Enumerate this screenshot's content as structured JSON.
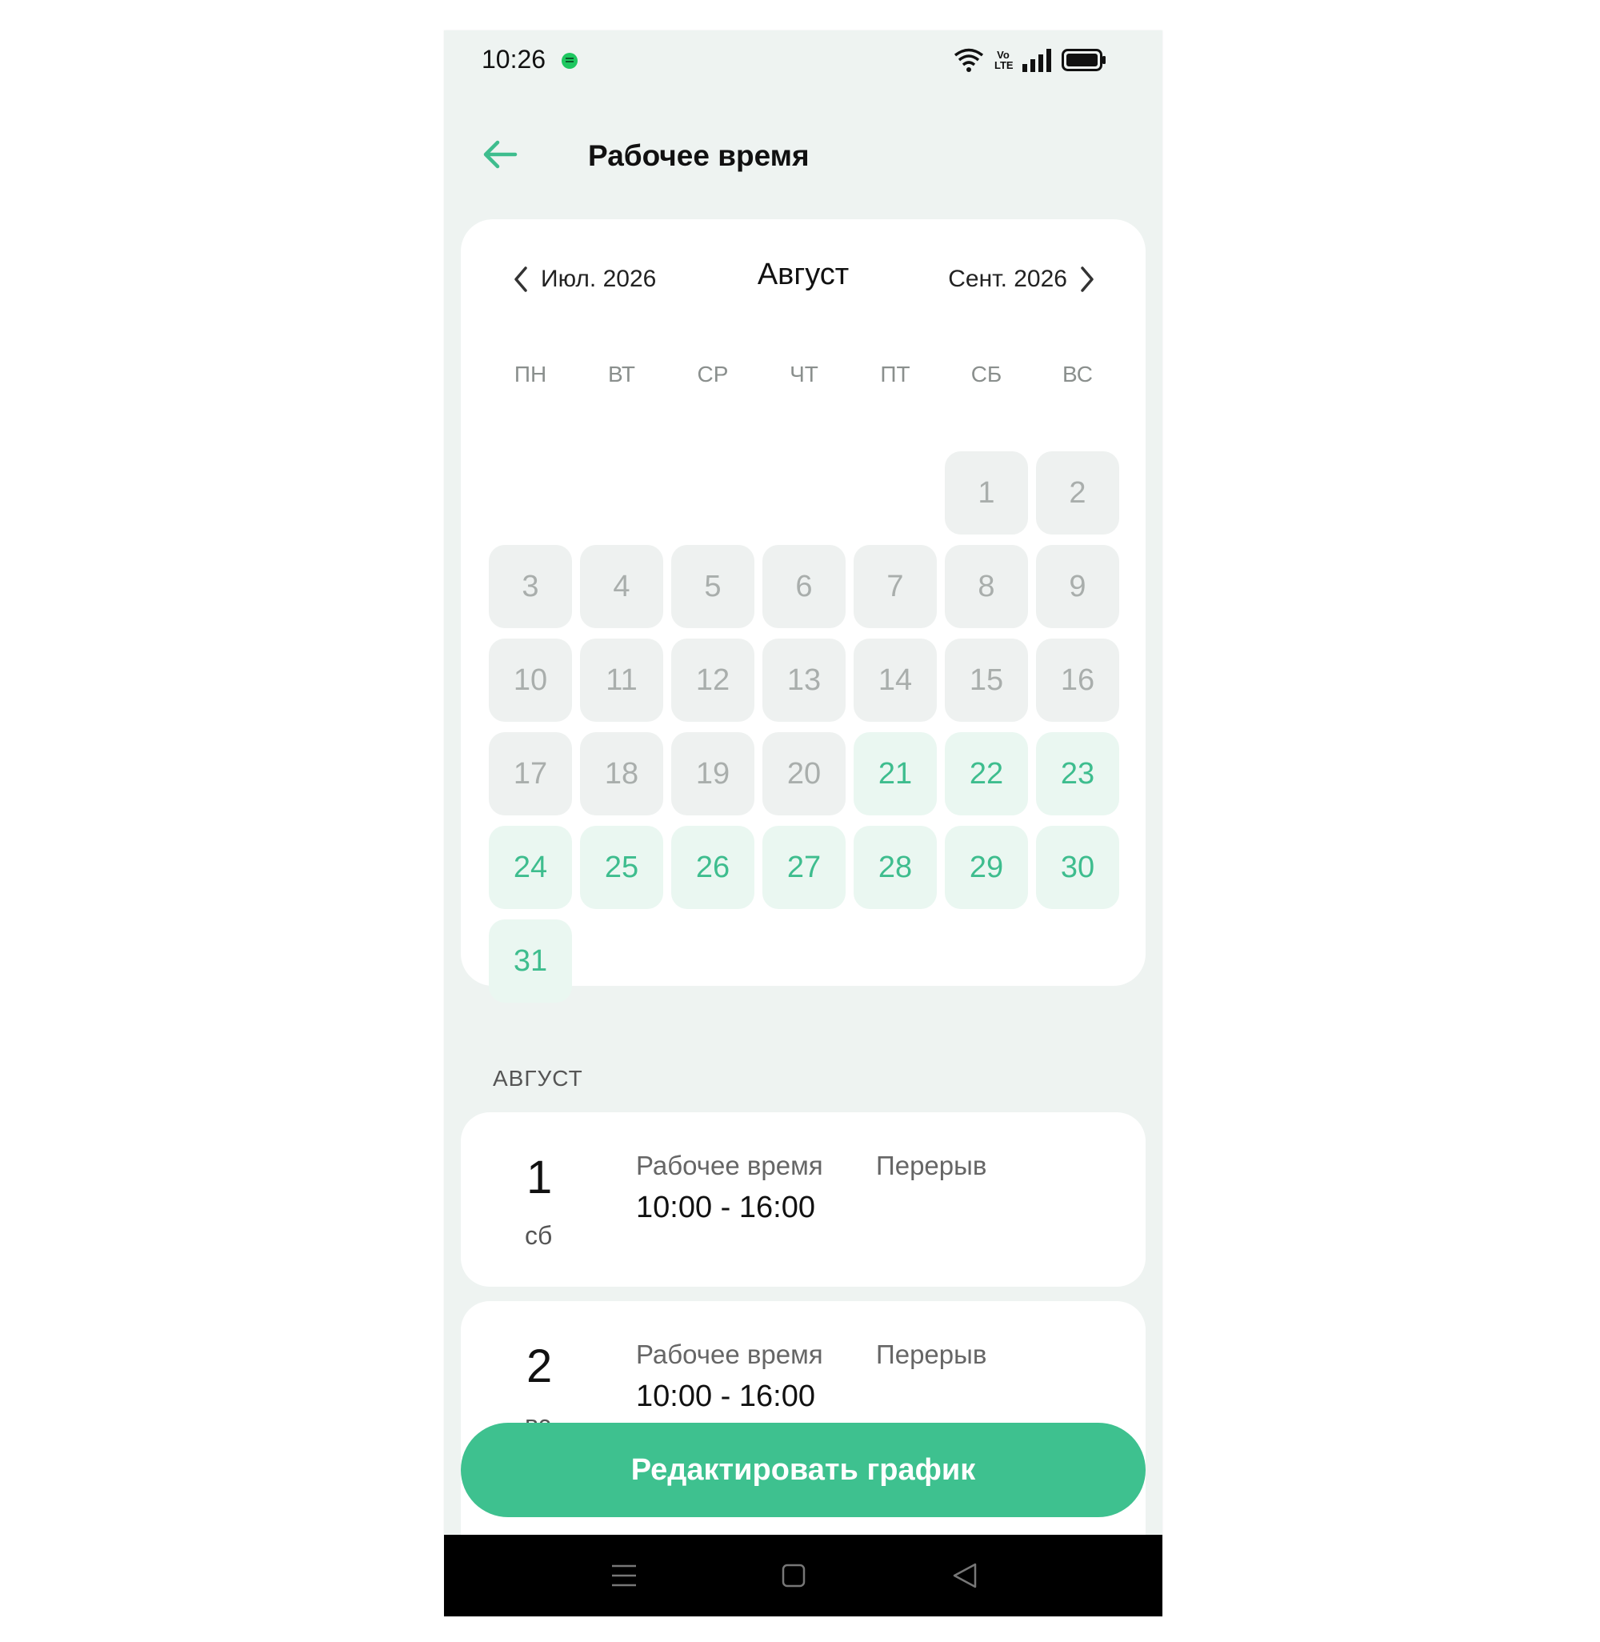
{
  "status_bar": {
    "time": "10:26",
    "volte": "Vo LTE"
  },
  "header": {
    "title": "Рабочее время"
  },
  "calendar": {
    "prev_month": "Июл. 2026",
    "current_month": "Август",
    "next_month": "Сент. 2026",
    "weekdays": [
      "ПН",
      "ВТ",
      "СР",
      "ЧТ",
      "ПТ",
      "СБ",
      "ВС"
    ],
    "leading_blanks": 5,
    "days": [
      {
        "label": "1",
        "state": "past"
      },
      {
        "label": "2",
        "state": "past"
      },
      {
        "label": "3",
        "state": "past"
      },
      {
        "label": "4",
        "state": "past"
      },
      {
        "label": "5",
        "state": "past"
      },
      {
        "label": "6",
        "state": "past"
      },
      {
        "label": "7",
        "state": "past"
      },
      {
        "label": "8",
        "state": "past"
      },
      {
        "label": "9",
        "state": "past"
      },
      {
        "label": "10",
        "state": "past"
      },
      {
        "label": "11",
        "state": "past"
      },
      {
        "label": "12",
        "state": "past"
      },
      {
        "label": "13",
        "state": "past"
      },
      {
        "label": "14",
        "state": "past"
      },
      {
        "label": "15",
        "state": "past"
      },
      {
        "label": "16",
        "state": "past"
      },
      {
        "label": "17",
        "state": "past"
      },
      {
        "label": "18",
        "state": "past"
      },
      {
        "label": "19",
        "state": "past"
      },
      {
        "label": "20",
        "state": "past"
      },
      {
        "label": "21",
        "state": "future"
      },
      {
        "label": "22",
        "state": "future"
      },
      {
        "label": "23",
        "state": "future"
      },
      {
        "label": "24",
        "state": "future"
      },
      {
        "label": "25",
        "state": "future"
      },
      {
        "label": "26",
        "state": "future"
      },
      {
        "label": "27",
        "state": "future"
      },
      {
        "label": "28",
        "state": "future"
      },
      {
        "label": "29",
        "state": "future"
      },
      {
        "label": "30",
        "state": "future"
      },
      {
        "label": "31",
        "state": "future"
      }
    ]
  },
  "schedule": {
    "month_label": "АВГУСТ",
    "entries": [
      {
        "day": "1",
        "weekday": "сб",
        "work_label": "Рабочее время",
        "work_time": "10:00 - 16:00",
        "break_label": "Перерыв"
      },
      {
        "day": "2",
        "weekday": "вс",
        "work_label": "Рабочее время",
        "work_time": "10:00 - 16:00",
        "break_label": "Перерыв"
      }
    ]
  },
  "edit_button": {
    "label": "Редактировать график"
  },
  "colors": {
    "accent": "#3ec18f",
    "future_day_bg": "#eaf7f1",
    "past_day_bg": "#eef1f0",
    "screen_bg": "#eef3f1"
  }
}
